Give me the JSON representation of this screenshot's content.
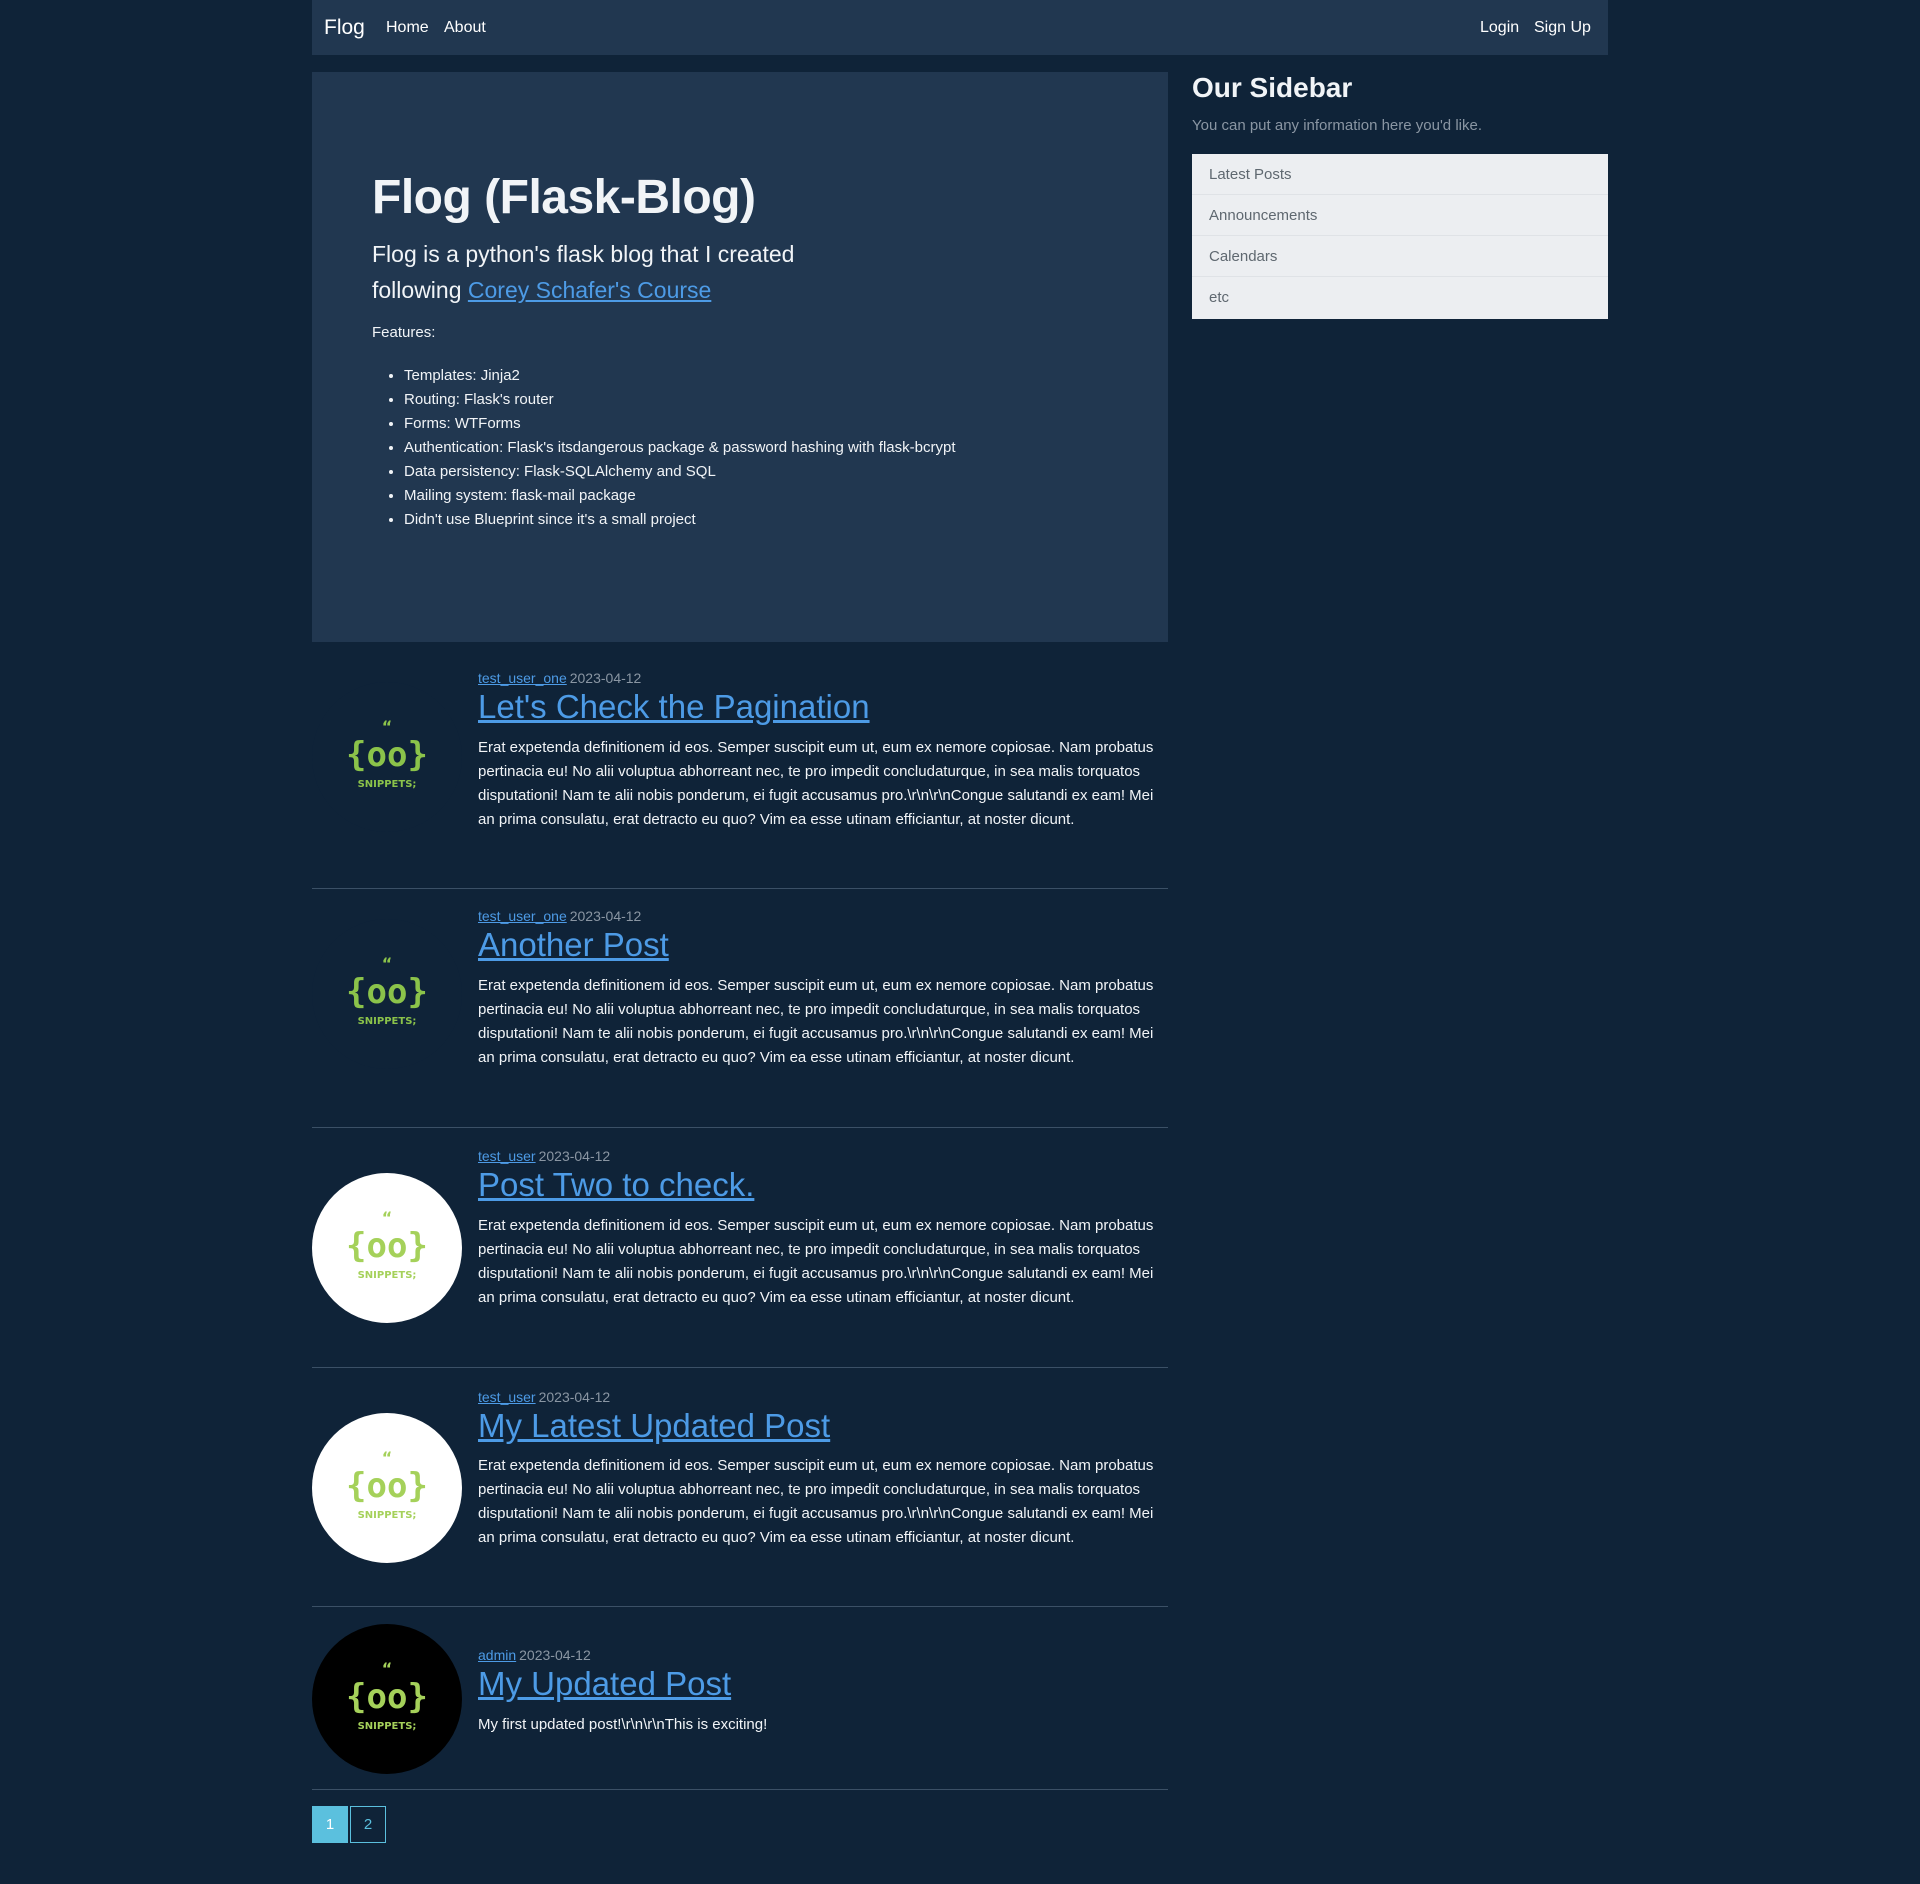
{
  "nav": {
    "brand": "Flog",
    "links": [
      "Home",
      "About"
    ],
    "auth": [
      "Login",
      "Sign Up"
    ]
  },
  "hero": {
    "title": "Flog (Flask-Blog)",
    "lead_prefix": "Flog is a python's flask blog that I created following ",
    "lead_link": "Corey Schafer's Course",
    "features_label": "Features:",
    "features": [
      "Templates: Jinja2",
      "Routing: Flask's router",
      "Forms: WTForms",
      "Authentication: Flask's itsdangerous package & password hashing with flask-bcrypt",
      "Data persistency: Flask-SQLAlchemy and SQL",
      "Mailing system: flask-mail package",
      "Didn't use Blueprint since it's a small project"
    ]
  },
  "sidebar": {
    "title": "Our Sidebar",
    "muted": "You can put any information here you'd like.",
    "items": [
      "Latest Posts",
      "Announcements",
      "Calendars",
      "etc"
    ]
  },
  "posts": [
    {
      "author": "test_user_one",
      "date": "2023-04-12",
      "title": "Let's Check the Pagination",
      "content": "Erat expetenda definitionem id eos. Semper suscipit eum ut, eum ex nemore copiosae. Nam probatus pertinacia eu! No alii voluptua abhorreant nec, te pro impedit concludaturque, in sea malis torquatos disputationi! Nam te alii nobis ponderum, ei fugit accusamus pro.\\r\\n\\r\\nCongue salutandi ex eam! Mei an prima consulatu, erat detracto eu quo? Vim ea esse utinam efficiantur, at noster dicunt.",
      "avatar_logo_text": "SNIPPETS;"
    },
    {
      "author": "test_user_one",
      "date": "2023-04-12",
      "title": "Another Post",
      "content": "Erat expetenda definitionem id eos. Semper suscipit eum ut, eum ex nemore copiosae. Nam probatus pertinacia eu! No alii voluptua abhorreant nec, te pro impedit concludaturque, in sea malis torquatos disputationi! Nam te alii nobis ponderum, ei fugit accusamus pro.\\r\\n\\r\\nCongue salutandi ex eam! Mei an prima consulatu, erat detracto eu quo? Vim ea esse utinam efficiantur, at noster dicunt.",
      "avatar_logo_text": "SNIPPETS;"
    },
    {
      "author": "test_user",
      "date": "2023-04-12",
      "title": "Post Two to check.",
      "content": "Erat expetenda definitionem id eos. Semper suscipit eum ut, eum ex nemore copiosae. Nam probatus pertinacia eu! No alii voluptua abhorreant nec, te pro impedit concludaturque, in sea malis torquatos disputationi! Nam te alii nobis ponderum, ei fugit accusamus pro.\\r\\n\\r\\nCongue salutandi ex eam! Mei an prima consulatu, erat detracto eu quo? Vim ea esse utinam efficiantur, at noster dicunt.",
      "avatar_logo_text": "SNIPPETS;"
    },
    {
      "author": "test_user",
      "date": "2023-04-12",
      "title": "My Latest Updated Post",
      "content": "Erat expetenda definitionem id eos. Semper suscipit eum ut, eum ex nemore copiosae. Nam probatus pertinacia eu! No alii voluptua abhorreant nec, te pro impedit concludaturque, in sea malis torquatos disputationi! Nam te alii nobis ponderum, ei fugit accusamus pro.\\r\\n\\r\\nCongue salutandi ex eam! Mei an prima consulatu, erat detracto eu quo? Vim ea esse utinam efficiantur, at noster dicunt.",
      "avatar_logo_text": "SNIPPETS;"
    },
    {
      "author": "admin",
      "date": "2023-04-12",
      "title": "My Updated Post",
      "content": "My first updated post!\\r\\n\\r\\nThis is exciting!",
      "avatar_logo_text": "SNIPPETS;"
    }
  ],
  "pagination": {
    "pages": [
      "1",
      "2"
    ],
    "current": "1"
  },
  "colors": {
    "background": "#0f2338",
    "panel": "#213750",
    "link": "#4d9be6",
    "logo_green": "#8bc34a",
    "page_active": "#5bc0de"
  },
  "icons": {
    "avatar": "snippets-logo-icon"
  }
}
